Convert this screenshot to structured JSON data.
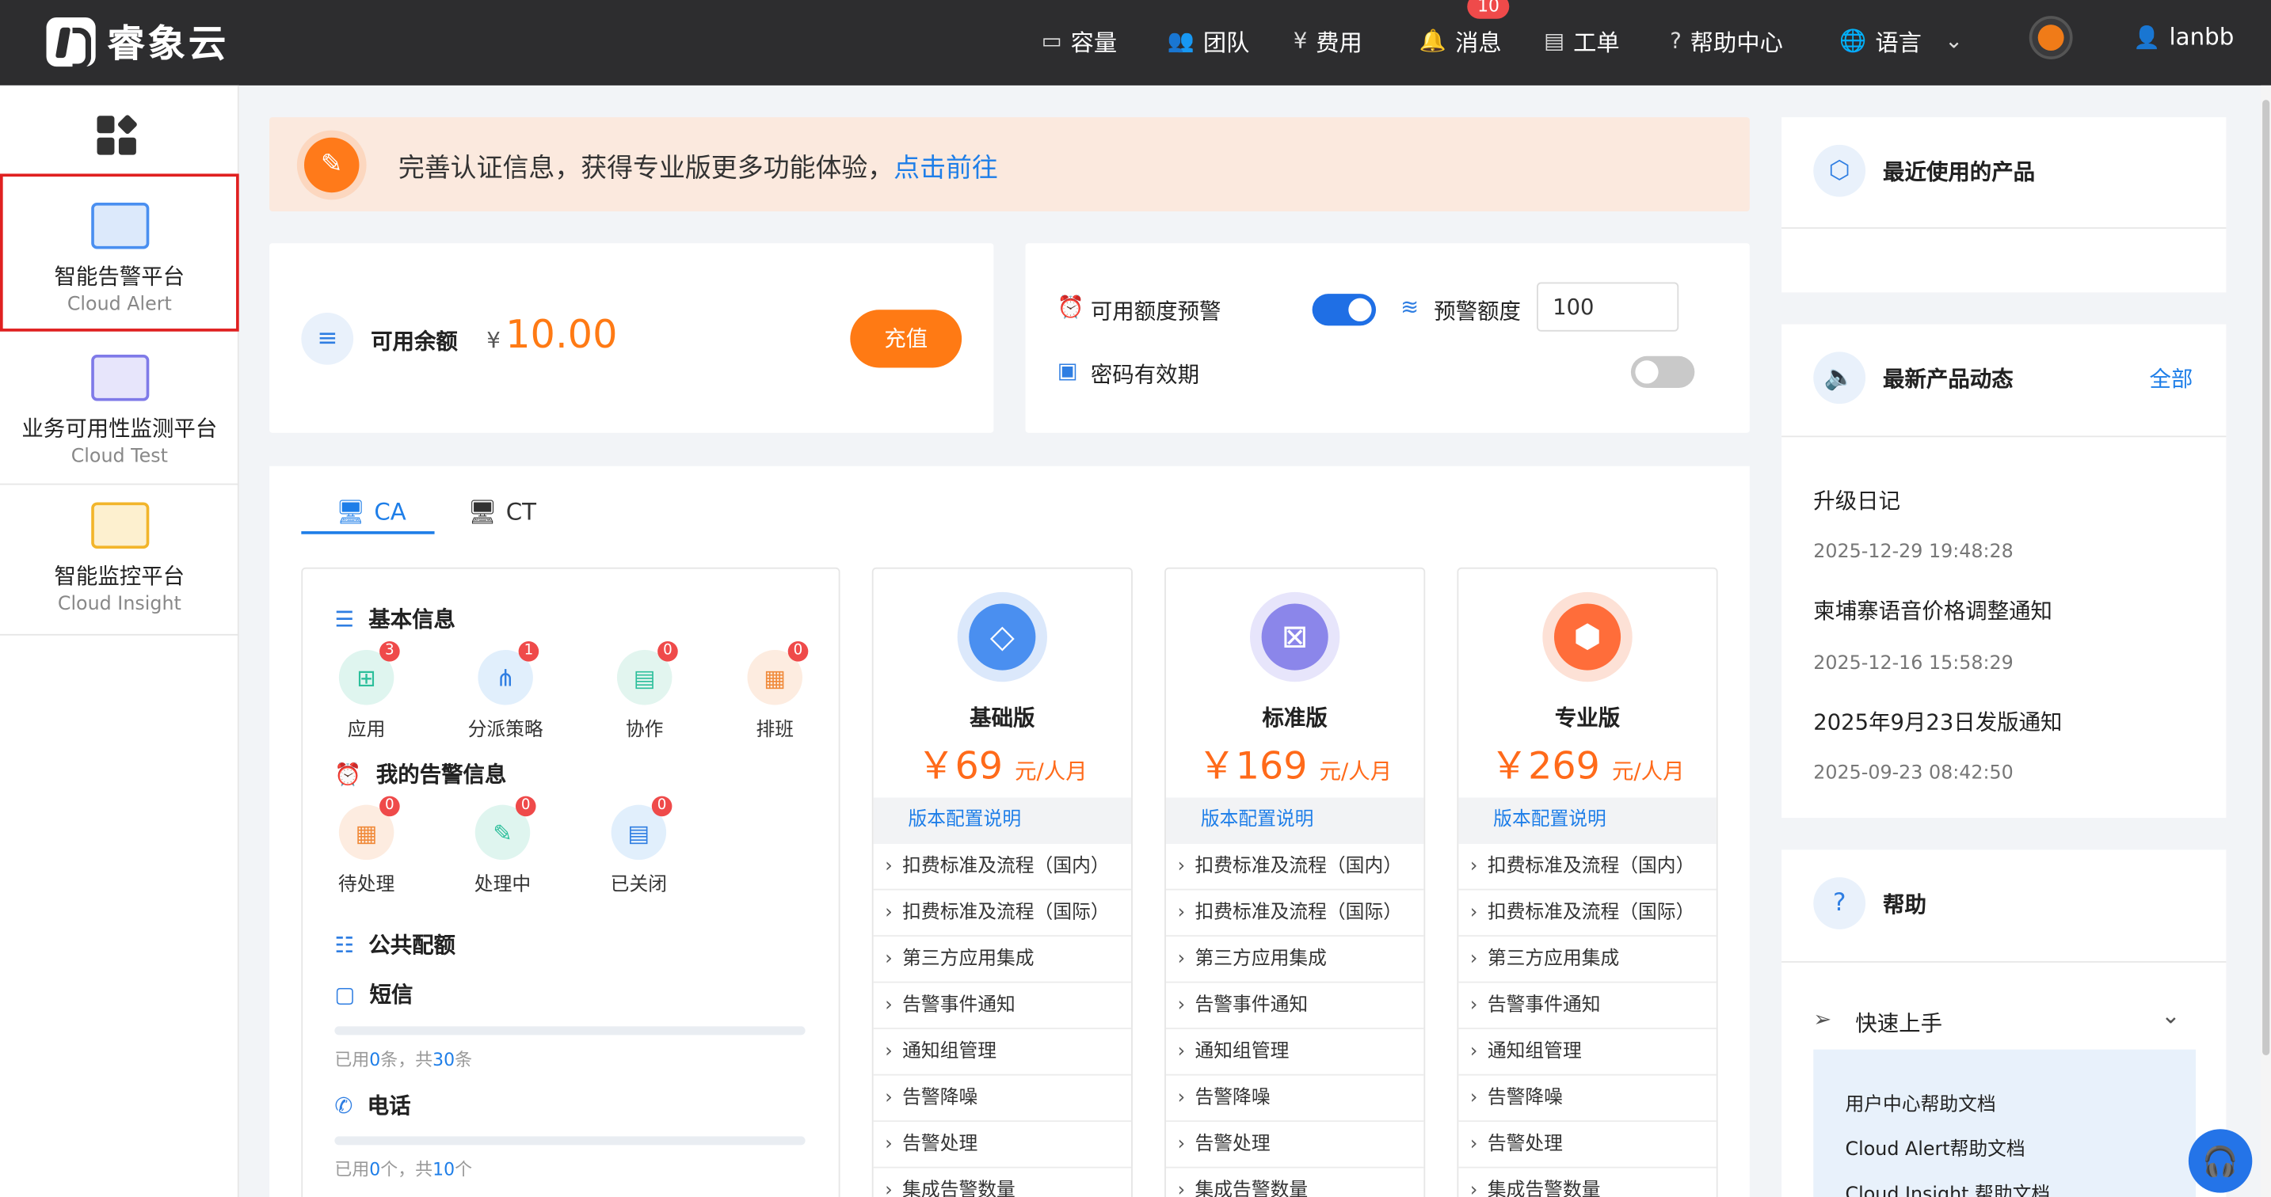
{
  "topbar": {
    "brand": "睿象云",
    "nav": [
      {
        "label": "容量",
        "icon": "storage-icon"
      },
      {
        "label": "团队",
        "icon": "team-icon"
      },
      {
        "label": "费用",
        "icon": "yen-icon"
      },
      {
        "label": "消息",
        "icon": "bell-icon"
      },
      {
        "label": "工单",
        "icon": "ticket-icon"
      },
      {
        "label": "帮助中心",
        "icon": "help-icon"
      },
      {
        "label": "语言",
        "icon": "globe-icon"
      }
    ],
    "message_badge": "10",
    "username": "lanbb"
  },
  "sidebar": {
    "items": [
      {
        "zh": "智能告警平台",
        "en": "Cloud Alert",
        "active": true
      },
      {
        "zh": "业务可用性监测平台",
        "en": "Cloud Test",
        "active": false
      },
      {
        "zh": "智能监控平台",
        "en": "Cloud Insight",
        "active": false
      }
    ]
  },
  "banner": {
    "text": "完善认证信息，获得专业版更多功能体验，",
    "link": "点击前往"
  },
  "balance": {
    "label": "可用余额",
    "currency": "¥",
    "amount": "10.00",
    "recharge": "充值"
  },
  "alert_settings": {
    "quota_alert_label": "可用额度预警",
    "quota_alert_on": true,
    "threshold_label": "预警额度",
    "threshold_value": "100",
    "password_expiry_label": "密码有效期",
    "password_expiry_on": false
  },
  "tabs": [
    {
      "label": "CA",
      "active": true
    },
    {
      "label": "CT",
      "active": false
    }
  ],
  "basic_info": {
    "title": "基本信息",
    "items": [
      {
        "label": "应用",
        "count": "3"
      },
      {
        "label": "分派策略",
        "count": "1"
      },
      {
        "label": "协作",
        "count": "0"
      },
      {
        "label": "排班",
        "count": "0"
      }
    ]
  },
  "my_alerts": {
    "title": "我的告警信息",
    "items": [
      {
        "label": "待处理",
        "count": "0"
      },
      {
        "label": "处理中",
        "count": "0"
      },
      {
        "label": "已关闭",
        "count": "0"
      }
    ]
  },
  "public_quota": {
    "title": "公共配额",
    "sms": {
      "title": "短信",
      "used_prefix": "已用",
      "used": "0",
      "used_unit": "条，共",
      "total": "30",
      "total_unit": "条"
    },
    "phone": {
      "title": "电话",
      "used_prefix": "已用",
      "used": "0",
      "used_unit": "个，共",
      "total": "10",
      "total_unit": "个"
    }
  },
  "plans": [
    {
      "name": "基础版",
      "price": "￥69",
      "unit": "元/人月",
      "color": "#4a8ff0",
      "ring": "#dbe8fb"
    },
    {
      "name": "标准版",
      "price": "￥169",
      "unit": "元/人月",
      "color": "#8b86ea",
      "ring": "#e7e5fb"
    },
    {
      "name": "专业版",
      "price": "￥269",
      "unit": "元/人月",
      "color": "#ff6d3a",
      "ring": "#fde1d6"
    }
  ],
  "plan_config_label": "版本配置说明",
  "plan_features": [
    "扣费标准及流程（国内）",
    "扣费标准及流程（国际）",
    "第三方应用集成",
    "告警事件通知",
    "通知组管理",
    "告警降噪",
    "告警处理",
    "集成告警数量"
  ],
  "recent_products": {
    "title": "最近使用的产品"
  },
  "news": {
    "title": "最新产品动态",
    "all": "全部",
    "items": [
      {
        "title": "升级日记",
        "date": "2025-12-29 19:48:28"
      },
      {
        "title": "柬埔寨语音价格调整通知",
        "date": "2025-12-16 15:58:29"
      },
      {
        "title": "2025年9月23日发版通知",
        "date": "2025-09-23 08:42:50"
      }
    ]
  },
  "help": {
    "title": "帮助",
    "quick_start": "快速上手",
    "links": [
      "用户中心帮助文档",
      "Cloud Alert帮助文档",
      "Cloud Insight 帮助文档"
    ]
  }
}
